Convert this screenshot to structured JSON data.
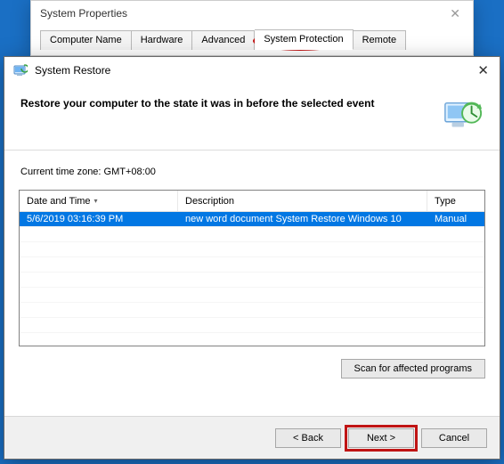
{
  "sysprops": {
    "title": "System Properties",
    "tabs": [
      {
        "label": "Computer Name"
      },
      {
        "label": "Hardware"
      },
      {
        "label": "Advanced"
      },
      {
        "label": "System Protection"
      },
      {
        "label": "Remote"
      }
    ]
  },
  "restore": {
    "title": "System Restore",
    "heading": "Restore your computer to the state it was in before the selected event",
    "timezone_label": "Current time zone: GMT+08:00",
    "columns": {
      "datetime": "Date and Time",
      "description": "Description",
      "type": "Type"
    },
    "rows": [
      {
        "datetime": "5/6/2019 03:16:39 PM",
        "description": "new word document System Restore Windows 10",
        "type": "Manual"
      }
    ],
    "buttons": {
      "scan": "Scan for affected programs",
      "back": "< Back",
      "next": "Next >",
      "cancel": "Cancel"
    }
  }
}
